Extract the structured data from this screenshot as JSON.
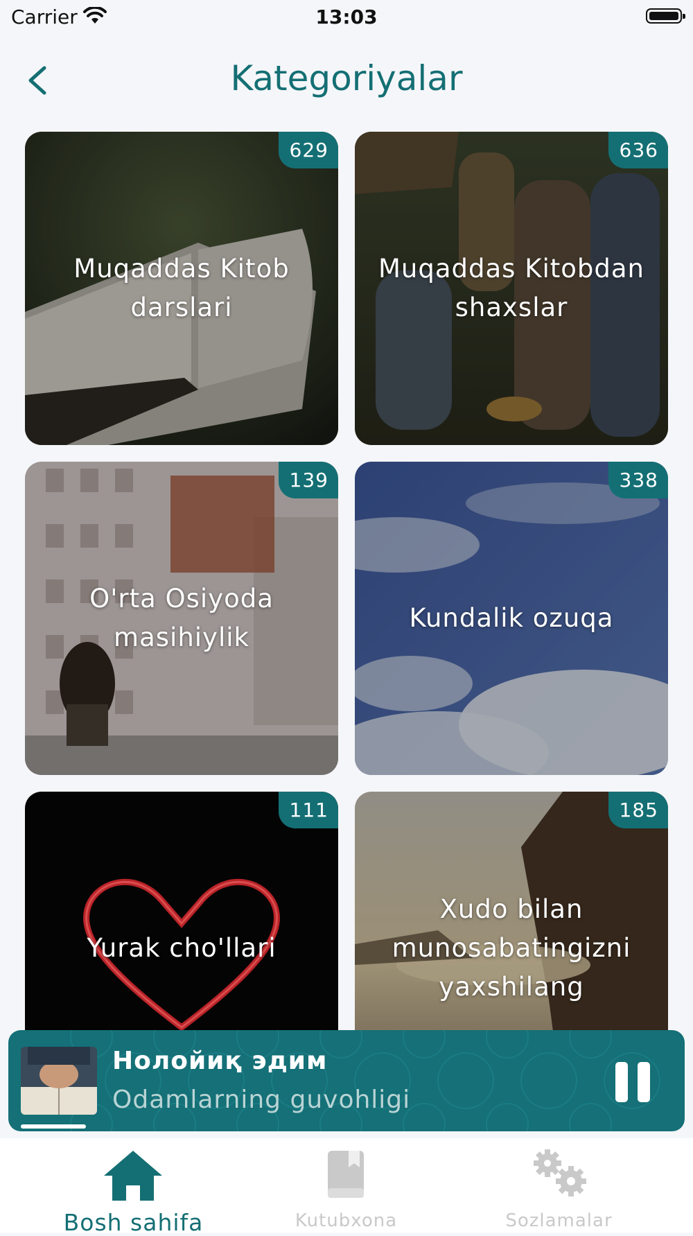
{
  "status_bar": {
    "carrier": "Carrier",
    "time": "13:03"
  },
  "header": {
    "title": "Kategoriyalar"
  },
  "categories": [
    {
      "title": "Muqaddas Kitob darslari",
      "count": "629"
    },
    {
      "title": "Muqaddas Kitobdan shaxslar",
      "count": "636"
    },
    {
      "title": "O'rta Osiyoda masihiylik",
      "count": "139"
    },
    {
      "title": "Kundalik ozuqa",
      "count": "338"
    },
    {
      "title": "Yurak cho'llari",
      "count": "111"
    },
    {
      "title": "Xudo bilan munosabatingizni yaxshilang",
      "count": "185"
    }
  ],
  "player": {
    "title": "Нолойиқ эдим",
    "subtitle": "Odamlarning guvohligi",
    "progress_fraction": 0.1,
    "accent": "#146f74"
  },
  "tabs": [
    {
      "label": "Bosh sahifa",
      "icon": "home-icon",
      "active": true
    },
    {
      "label": "Kutubxona",
      "icon": "library-book-icon",
      "active": false
    },
    {
      "label": "Sozlamalar",
      "icon": "settings-gears-icon",
      "active": false
    }
  ]
}
